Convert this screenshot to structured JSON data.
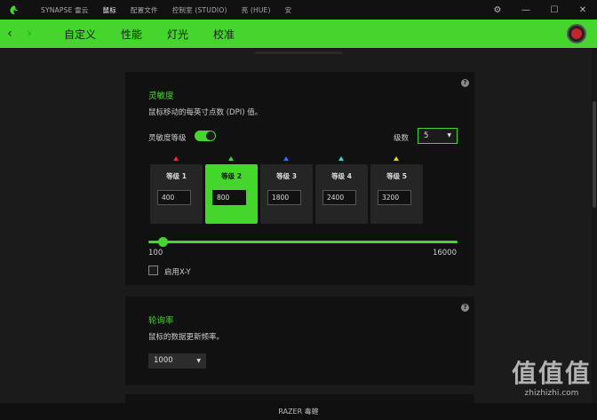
{
  "titlebar": {
    "tabs": [
      {
        "label": "SYNAPSE 雷云"
      },
      {
        "label": "鼠标"
      },
      {
        "label": "配置文件"
      },
      {
        "label": "控制室 (STUDIO)"
      },
      {
        "label": "亮 (HUE)"
      },
      {
        "label": "安"
      }
    ],
    "active_tab": "鼠标",
    "controls": {
      "settings": "⚙",
      "minimize": "—",
      "maximize": "☐",
      "close": "✕"
    }
  },
  "subbar": {
    "tabs": [
      {
        "label": "自定义"
      },
      {
        "label": "性能"
      },
      {
        "label": "灯光"
      },
      {
        "label": "校准"
      }
    ],
    "active_tab": "性能",
    "back": "‹",
    "forward": "›"
  },
  "sensitivity": {
    "title": "灵敏度",
    "description": "鼠标移动的每英寸点数 (DPI) 值。",
    "stages_label": "灵敏度等级",
    "stages_enabled": true,
    "levels_label": "级数",
    "levels_value": "5",
    "help": "?",
    "stages": [
      {
        "title": "等级 1",
        "value": "400",
        "color": "#e0322f"
      },
      {
        "title": "等级 2",
        "value": "800",
        "color": "#44d62c"
      },
      {
        "title": "等级 3",
        "value": "1800",
        "color": "#2f6bff"
      },
      {
        "title": "等级 4",
        "value": "2400",
        "color": "#2fd6e0"
      },
      {
        "title": "等级 5",
        "value": "3200",
        "color": "#f0d020"
      }
    ],
    "active_stage": 2,
    "slider_min": "100",
    "slider_max": "16000",
    "slider_value_fraction": 0.045,
    "xy_label": "启用X-Y",
    "xy_enabled": false
  },
  "polling": {
    "title": "轮询率",
    "description": "鼠标的数据更新频率。",
    "value": "1000",
    "help": "?"
  },
  "footer": {
    "device": "RAZER 毒蝰"
  },
  "watermark": {
    "big": "值值值",
    "small": "zhizhizhi.com"
  },
  "colors": {
    "accent": "#44d62c",
    "background": "#1b1b1b",
    "card": "#111111"
  }
}
